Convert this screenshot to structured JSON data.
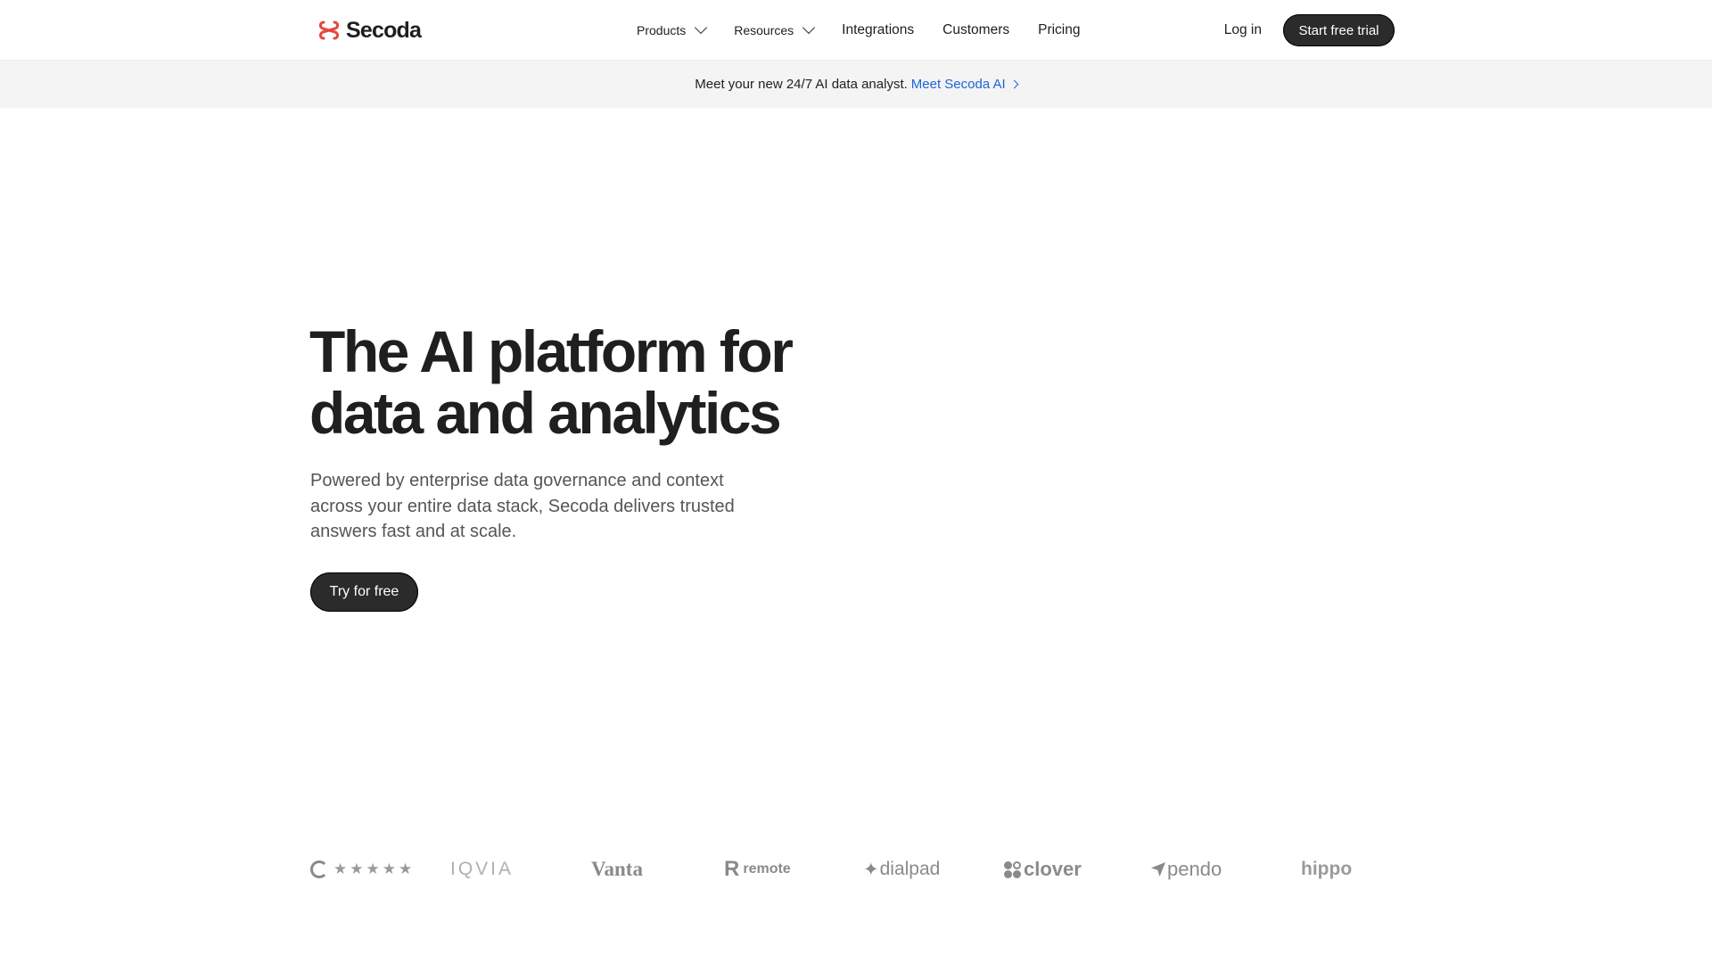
{
  "nav": {
    "brand": "Secoda",
    "brand_color": "#e5483a",
    "items": [
      {
        "label": "Products",
        "has_dropdown": true
      },
      {
        "label": "Resources",
        "has_dropdown": true
      },
      {
        "label": "Integrations",
        "has_dropdown": false
      },
      {
        "label": "Customers",
        "has_dropdown": false
      },
      {
        "label": "Pricing",
        "has_dropdown": false
      }
    ],
    "login_label": "Log in",
    "cta_label": "Start free trial"
  },
  "banner": {
    "text": "Meet your new 24/7 AI data analyst.",
    "link_label": "Meet Secoda AI",
    "link_color": "#1a66d9"
  },
  "hero": {
    "title_line1": "The AI platform for",
    "title_line2": "data and analytics",
    "subtitle": "Powered by enterprise data governance and context across your entire data stack, Secoda delivers trusted answers fast and at scale.",
    "cta_label": "Try for free"
  },
  "logos": {
    "g2_stars": "★★★★★",
    "items": [
      "IQVIA",
      "Vanta",
      "remote",
      "dialpad",
      "clover",
      "pendo",
      "hippo"
    ]
  },
  "colors": {
    "button_bg": "#2b2b2b",
    "banner_bg": "#f4f4f4",
    "logo_gray": "#8a8a8a"
  }
}
